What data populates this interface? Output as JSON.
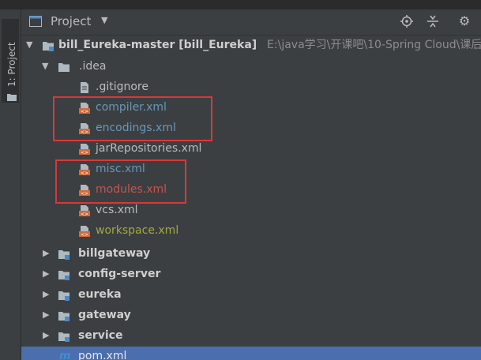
{
  "sidebar": {
    "tab_label": "1: Project"
  },
  "toolbar": {
    "title": "Project",
    "dropdown_icon": "caret-down-icon"
  },
  "tree": {
    "root": {
      "name": "bill_Eureka-master",
      "module": "[bill_Eureka]",
      "path": "E:\\java学习\\开课吧\\10-Spring Cloud\\课后作"
    },
    "idea_folder": ".idea",
    "idea_files": [
      {
        "name": ".gitignore",
        "color": "#bbbbbb"
      },
      {
        "name": "compiler.xml",
        "color": "#6897bb"
      },
      {
        "name": "encodings.xml",
        "color": "#6897bb"
      },
      {
        "name": "jarRepositories.xml",
        "color": "#bbbbbb"
      },
      {
        "name": "misc.xml",
        "color": "#6897bb"
      },
      {
        "name": "modules.xml",
        "color": "#c75450"
      },
      {
        "name": "vcs.xml",
        "color": "#bbbbbb"
      },
      {
        "name": "workspace.xml",
        "color": "#a5a83c"
      }
    ],
    "modules": [
      "billgateway",
      "config-server",
      "eureka",
      "gateway",
      "service"
    ],
    "pom": "pom.xml"
  },
  "colors": {
    "accent": "#4b6eaf",
    "highlight_box": "#d9383a",
    "background": "#3c3f41"
  }
}
